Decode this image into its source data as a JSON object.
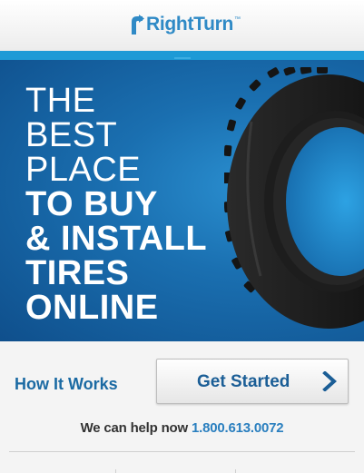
{
  "header": {
    "logo_text": "RightTurn",
    "logo_tm": "™"
  },
  "hero": {
    "headline_light": [
      "THE",
      "BEST",
      "PLACE"
    ],
    "headline_bold": [
      "TO BUY",
      "& INSTALL",
      "TIRES",
      "ONLINE"
    ]
  },
  "actions": {
    "how_it_works": "How It Works",
    "get_started": "Get Started",
    "help_prefix": "We can help now",
    "phone": "1.800.613.0072"
  },
  "colors": {
    "brand_blue": "#2f8ac6",
    "stripe_blue": "#1d9ad6",
    "link_blue": "#1b6aa3",
    "hero_dark": "#0f4f8c"
  },
  "icons": {
    "logo": "rightturn-logo-icon",
    "notch": "chevron-notch-icon",
    "tire": "tire-image",
    "chevron": "chevron-right-icon"
  }
}
